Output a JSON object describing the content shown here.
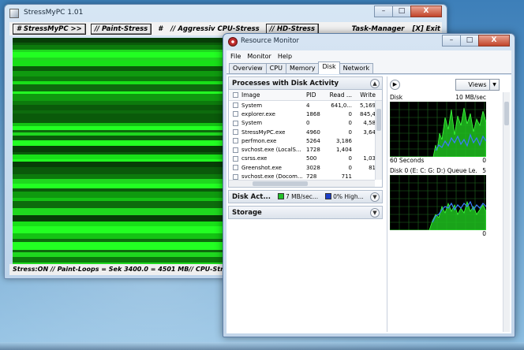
{
  "stress_window": {
    "title": "StressMyPC 1.01",
    "controls": {
      "minimize": "–",
      "maximize": "□",
      "close": "X"
    },
    "menu": {
      "stressmypc": "# StressMyPC >>",
      "paint": "// Paint-Stress",
      "hash": "#",
      "cpu": "// Aggressiv CPU-Stress",
      "hd": "// HD-Stress",
      "task_manager": "Task-Manager",
      "exit": "[X] Exit"
    },
    "status": "Stress:ON // Paint-Loops = Sek 3400.0 = 4501 MB// CPU-Stres"
  },
  "resmon_window": {
    "title": "Resource Monitor",
    "controls": {
      "minimize": "–",
      "maximize": "□",
      "close": "X"
    },
    "menu": [
      "File",
      "Monitor",
      "Help"
    ],
    "tabs": [
      "Overview",
      "CPU",
      "Memory",
      "Disk",
      "Network"
    ],
    "active_tab": "Disk",
    "processes_panel": {
      "title": "Processes with Disk Activity",
      "columns": {
        "image": "Image",
        "pid": "PID",
        "read": "Read ...",
        "write": "Write"
      },
      "rows": [
        {
          "image": "System",
          "pid": "4",
          "read": "641,0...",
          "write": "5,169"
        },
        {
          "image": "explorer.exe",
          "pid": "1868",
          "read": "0",
          "write": "845,4"
        },
        {
          "image": "System",
          "pid": "0",
          "read": "0",
          "write": "4,58"
        },
        {
          "image": "StressMyPC.exe",
          "pid": "4960",
          "read": "0",
          "write": "3,64"
        },
        {
          "image": "perfmon.exe",
          "pid": "5264",
          "read": "3,186",
          "write": ""
        },
        {
          "image": "svchost.exe (LocalS...",
          "pid": "1728",
          "read": "1,404",
          "write": ""
        },
        {
          "image": "csrss.exe",
          "pid": "500",
          "read": "0",
          "write": "1,03"
        },
        {
          "image": "Greenshot.exe",
          "pid": "3028",
          "read": "0",
          "write": "81"
        },
        {
          "image": "svchost.exe (Docom...",
          "pid": "728",
          "read": "711",
          "write": ""
        }
      ]
    },
    "disk_activity": {
      "title": "Disk Act...",
      "io_text": "7 MB/sec...",
      "io_color": "#22c02a",
      "active_text": "0% High...",
      "active_color": "#1e3fc8"
    },
    "storage": {
      "title": "Storage"
    },
    "graphs": {
      "views_label": "Views",
      "disk": {
        "name": "Disk",
        "max": "10 MB/sec",
        "footer_left": "60 Seconds",
        "footer_right": "0"
      },
      "queue": {
        "name": "Disk 0 (E: C: G: D:) Queue Le...",
        "max": "5",
        "footer_right": "0"
      }
    }
  }
}
